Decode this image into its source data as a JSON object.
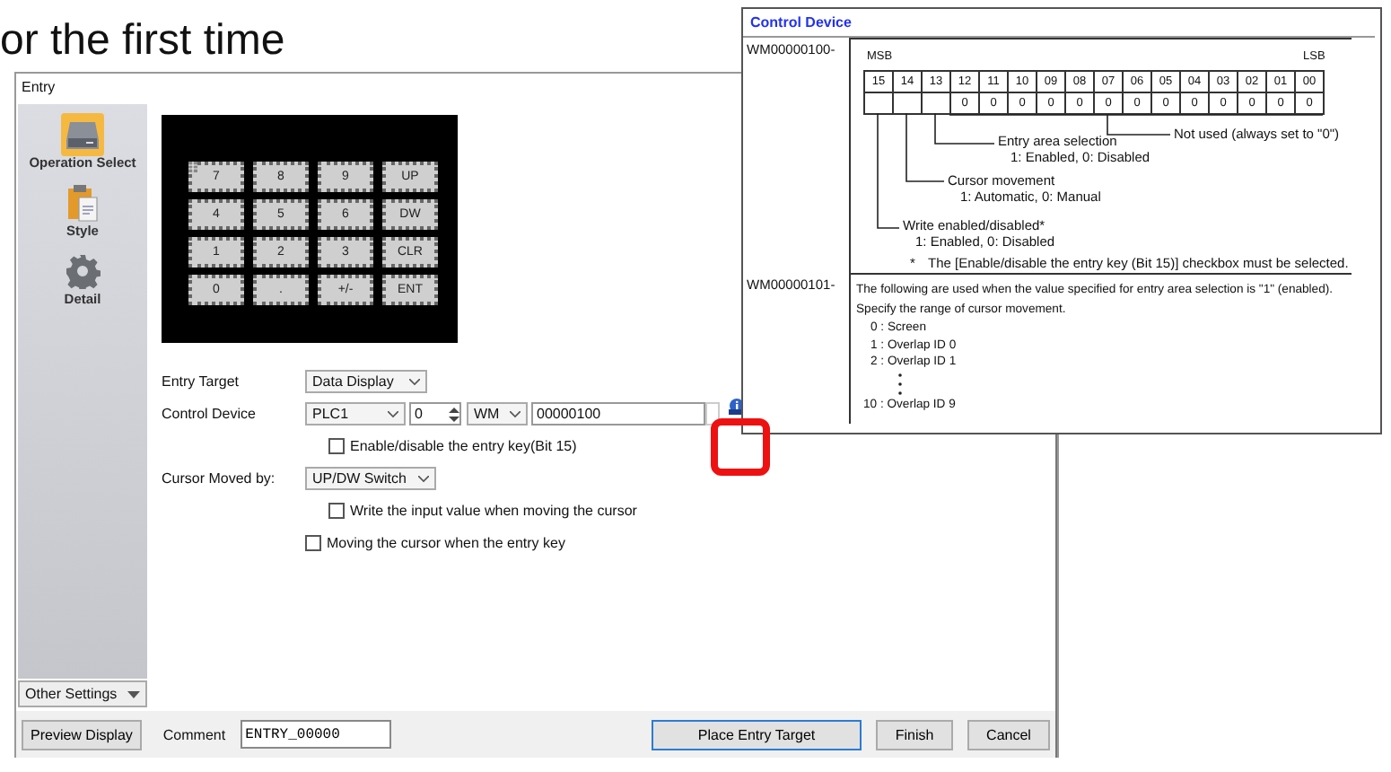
{
  "heading": "or the first time",
  "window": {
    "title": "Entry"
  },
  "sidebar": {
    "items": [
      {
        "label": "Operation Select",
        "kind": "drive",
        "selected": true
      },
      {
        "label": "Style",
        "kind": "clipboard",
        "selected": false
      },
      {
        "label": "Detail",
        "kind": "gear",
        "selected": false
      }
    ],
    "other_settings": "Other Settings"
  },
  "keypad": {
    "keys": [
      "7",
      "8",
      "9",
      "UP",
      "4",
      "5",
      "6",
      "DW",
      "1",
      "2",
      "3",
      "CLR",
      "0",
      ".",
      "+/-",
      "ENT"
    ]
  },
  "form": {
    "entry_target": {
      "label": "Entry Target",
      "value": "Data Display"
    },
    "control_device": {
      "label": "Control Device",
      "plc": "PLC1",
      "number": "0",
      "device": "WM",
      "address": "00000100"
    },
    "enable_key": {
      "label": "Enable/disable the entry key(Bit 15)",
      "checked": false
    },
    "cursor_moved_by": {
      "label": "Cursor Moved by:",
      "value": "UP/DW Switch"
    },
    "write_input": {
      "label": "Write the input value when moving the cursor",
      "checked": false
    },
    "moving_cursor": {
      "label": "Moving the cursor  when the entry key",
      "checked": false
    }
  },
  "footer": {
    "preview": "Preview Display",
    "comment_label": "Comment",
    "comment": "ENTRY_00000",
    "buttons": [
      {
        "label": "Place Entry Target",
        "default": true
      },
      {
        "label": "Finish",
        "default": false
      },
      {
        "label": "Cancel",
        "default": false
      }
    ]
  },
  "callout": {
    "title": "Control Device",
    "bits_row": {
      "address": "WM00000100-",
      "msb": "MSB",
      "lsb": "LSB",
      "bits": [
        {
          "bit": "15"
        },
        {
          "bit": "14"
        },
        {
          "bit": "13"
        },
        {
          "bit": "12",
          "value": "0"
        },
        {
          "bit": "11",
          "value": "0"
        },
        {
          "bit": "10",
          "value": "0"
        },
        {
          "bit": "09",
          "value": "0"
        },
        {
          "bit": "08",
          "value": "0"
        },
        {
          "bit": "07",
          "value": "0"
        },
        {
          "bit": "06",
          "value": "0"
        },
        {
          "bit": "05",
          "value": "0"
        },
        {
          "bit": "04",
          "value": "0"
        },
        {
          "bit": "03",
          "value": "0"
        },
        {
          "bit": "02",
          "value": "0"
        },
        {
          "bit": "01",
          "value": "0"
        },
        {
          "bit": "00",
          "value": "0"
        }
      ],
      "annotations": [
        {
          "text": "Entry area selection",
          "detail": "1: Enabled, 0: Disabled"
        },
        {
          "text": "Cursor movement",
          "detail": "1: Automatic, 0: Manual"
        },
        {
          "text": "Write enabled/disabled*",
          "detail": "1: Enabled, 0: Disabled"
        }
      ],
      "not_used": "Not used (always set to \"0\")",
      "note_mark": "*",
      "note": "The [Enable/disable the entry key (Bit 15)] checkbox must be selected."
    },
    "range_row": {
      "address": "WM00000101-",
      "lines": [
        "The following are used when the value specified for entry area selection is \"1\" (enabled).",
        "Specify the range of cursor  movement."
      ],
      "items": [
        {
          "num": "0",
          "sep": ":",
          "text": "Screen"
        },
        {
          "num": "1",
          "sep": ":",
          "text": "Overlap ID 0"
        },
        {
          "num": "2",
          "sep": ":",
          "text": "Overlap ID 1"
        },
        {
          "num": "10",
          "sep": ":",
          "text": "Overlap ID 9"
        }
      ]
    }
  }
}
